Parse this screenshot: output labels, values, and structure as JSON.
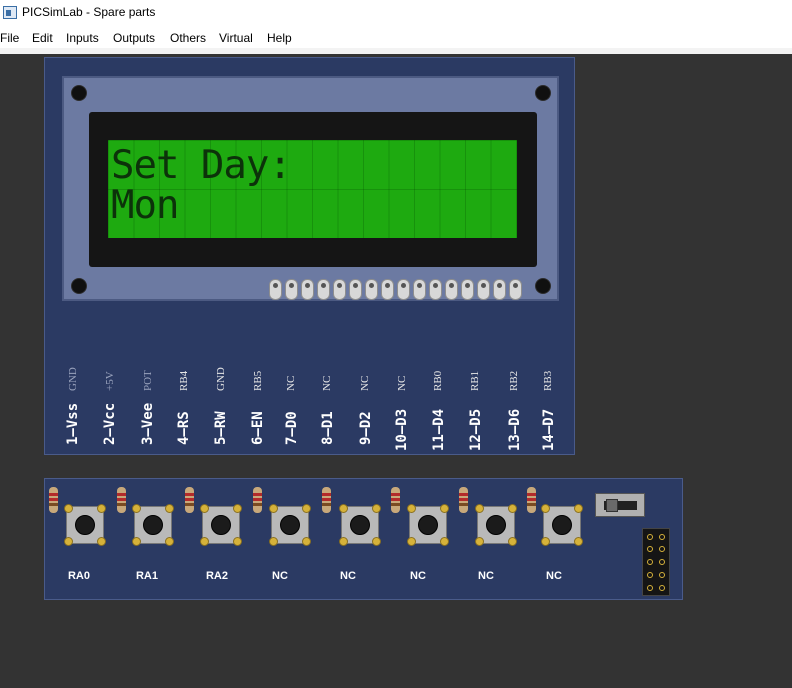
{
  "window": {
    "title": "PICSimLab - Spare parts"
  },
  "menu": [
    {
      "label": "File"
    },
    {
      "label": "Edit"
    },
    {
      "label": "Inputs"
    },
    {
      "label": "Outputs"
    },
    {
      "label": "Others"
    },
    {
      "label": "Virtual"
    },
    {
      "label": "Help"
    }
  ],
  "lcd": {
    "line1": "Set Day:",
    "line2": "Mon",
    "pins": [
      {
        "signal": "GND",
        "name": "1–Vss"
      },
      {
        "signal": "+5V",
        "name": "2–Vcc"
      },
      {
        "signal": "POT",
        "name": "3–Vee"
      },
      {
        "signal": "RB4",
        "name": "4–RS"
      },
      {
        "signal": "GND",
        "name": "5–RW"
      },
      {
        "signal": "RB5",
        "name": "6–EN"
      },
      {
        "signal": "NC",
        "name": "7–D0"
      },
      {
        "signal": "NC",
        "name": "8–D1"
      },
      {
        "signal": "NC",
        "name": "9–D2"
      },
      {
        "signal": "NC",
        "name": "10–D3"
      },
      {
        "signal": "RB0",
        "name": "11–D4"
      },
      {
        "signal": "RB1",
        "name": "12–D5"
      },
      {
        "signal": "RB2",
        "name": "13–D6"
      },
      {
        "signal": "RB3",
        "name": "14–D7"
      }
    ]
  },
  "buttons": {
    "labels": [
      "RA0",
      "RA1",
      "RA2",
      "NC",
      "NC",
      "NC",
      "NC",
      "NC"
    ]
  },
  "colors": {
    "board": "#2b3a63",
    "lcd_screen": "#1eaa10",
    "lcd_text": "#0c320a",
    "workspace": "#333333"
  }
}
